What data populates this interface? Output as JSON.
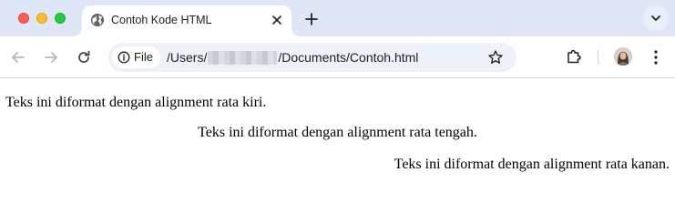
{
  "window": {
    "traffic_lights": [
      "close",
      "minimize",
      "zoom"
    ]
  },
  "tab": {
    "title": "Contoh Kode HTML",
    "favicon": "globe-icon"
  },
  "toolbar": {
    "back_icon": "arrow-left-icon",
    "forward_icon": "arrow-right-icon",
    "reload_icon": "reload-icon"
  },
  "omnibox": {
    "chip_label": "File",
    "url_prefix": "/Users/",
    "url_suffix": "/Documents/Contoh.html"
  },
  "page": {
    "paragraphs": {
      "left": "Teks ini diformat dengan alignment rata kiri.",
      "center": "Teks ini diformat dengan alignment rata tengah.",
      "right": "Teks ini diformat dengan alignment rata kanan."
    }
  },
  "colors": {
    "tabstrip_bg": "#dfe7f7",
    "omnibox_bg": "#edf2fa",
    "close": "#fe5f57",
    "minimize": "#febc2e",
    "zoom": "#28c840"
  }
}
